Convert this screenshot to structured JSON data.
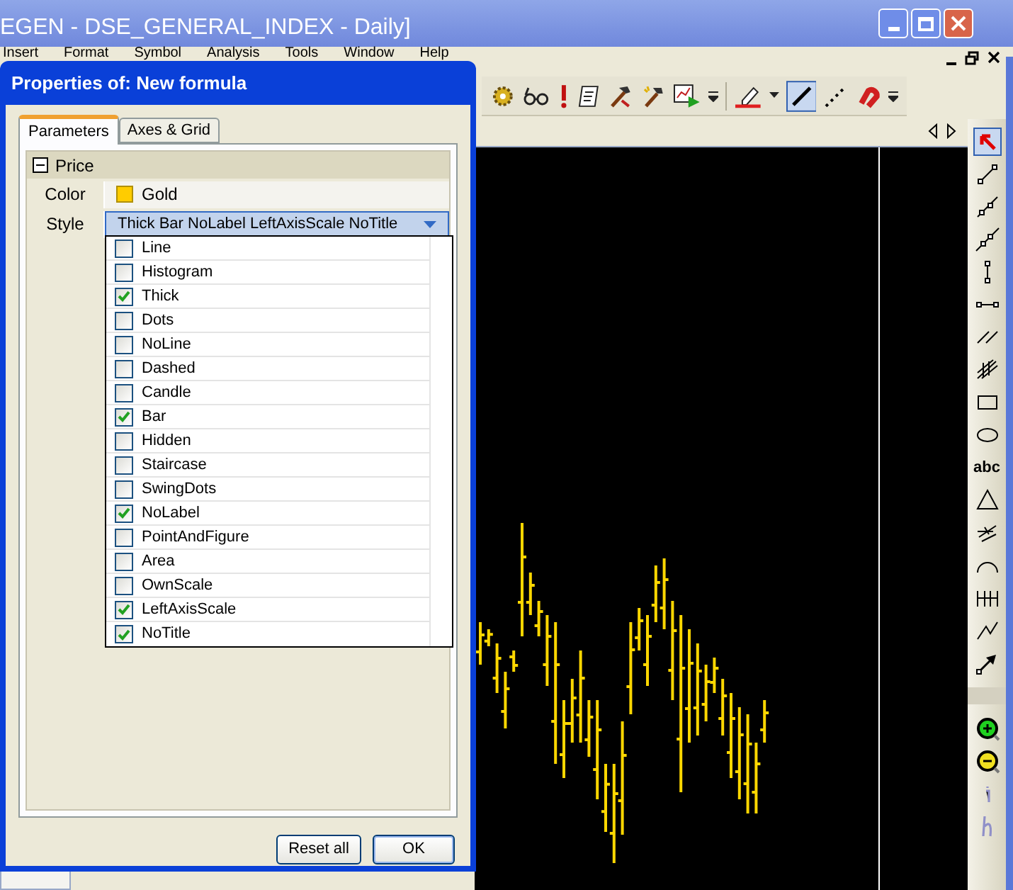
{
  "window": {
    "title": "EGEN - DSE_GENERAL_INDEX - Daily]"
  },
  "menu": [
    "Insert",
    "Format",
    "Symbol",
    "Analysis",
    "Tools",
    "Window",
    "Help"
  ],
  "text_tool": "abc",
  "dialog": {
    "title": "Properties of: New formula",
    "tabs": [
      {
        "label": "Parameters",
        "selected": true
      },
      {
        "label": "Axes & Grid",
        "selected": false
      }
    ],
    "section": {
      "label": "Price",
      "expanded": true
    },
    "properties": [
      {
        "kind": "color",
        "name": "Color",
        "value": "Gold",
        "color": "#ffcc00"
      },
      {
        "kind": "dropdown",
        "name": "Style",
        "value": "Thick Bar NoLabel LeftAxisScale NoTitle",
        "expanded": true
      }
    ],
    "style_options": [
      {
        "label": "Line",
        "checked": false
      },
      {
        "label": "Histogram",
        "checked": false
      },
      {
        "label": "Thick",
        "checked": true
      },
      {
        "label": "Dots",
        "checked": false
      },
      {
        "label": "NoLine",
        "checked": false
      },
      {
        "label": "Dashed",
        "checked": false
      },
      {
        "label": "Candle",
        "checked": false
      },
      {
        "label": "Bar",
        "checked": true
      },
      {
        "label": "Hidden",
        "checked": false
      },
      {
        "label": "Staircase",
        "checked": false
      },
      {
        "label": "SwingDots",
        "checked": false
      },
      {
        "label": "NoLabel",
        "checked": true
      },
      {
        "label": "PointAndFigure",
        "checked": false
      },
      {
        "label": "Area",
        "checked": false
      },
      {
        "label": "OwnScale",
        "checked": false
      },
      {
        "label": "LeftAxisScale",
        "checked": true
      },
      {
        "label": "NoTitle",
        "checked": true
      }
    ],
    "buttons": [
      "Reset all",
      "OK"
    ]
  }
}
